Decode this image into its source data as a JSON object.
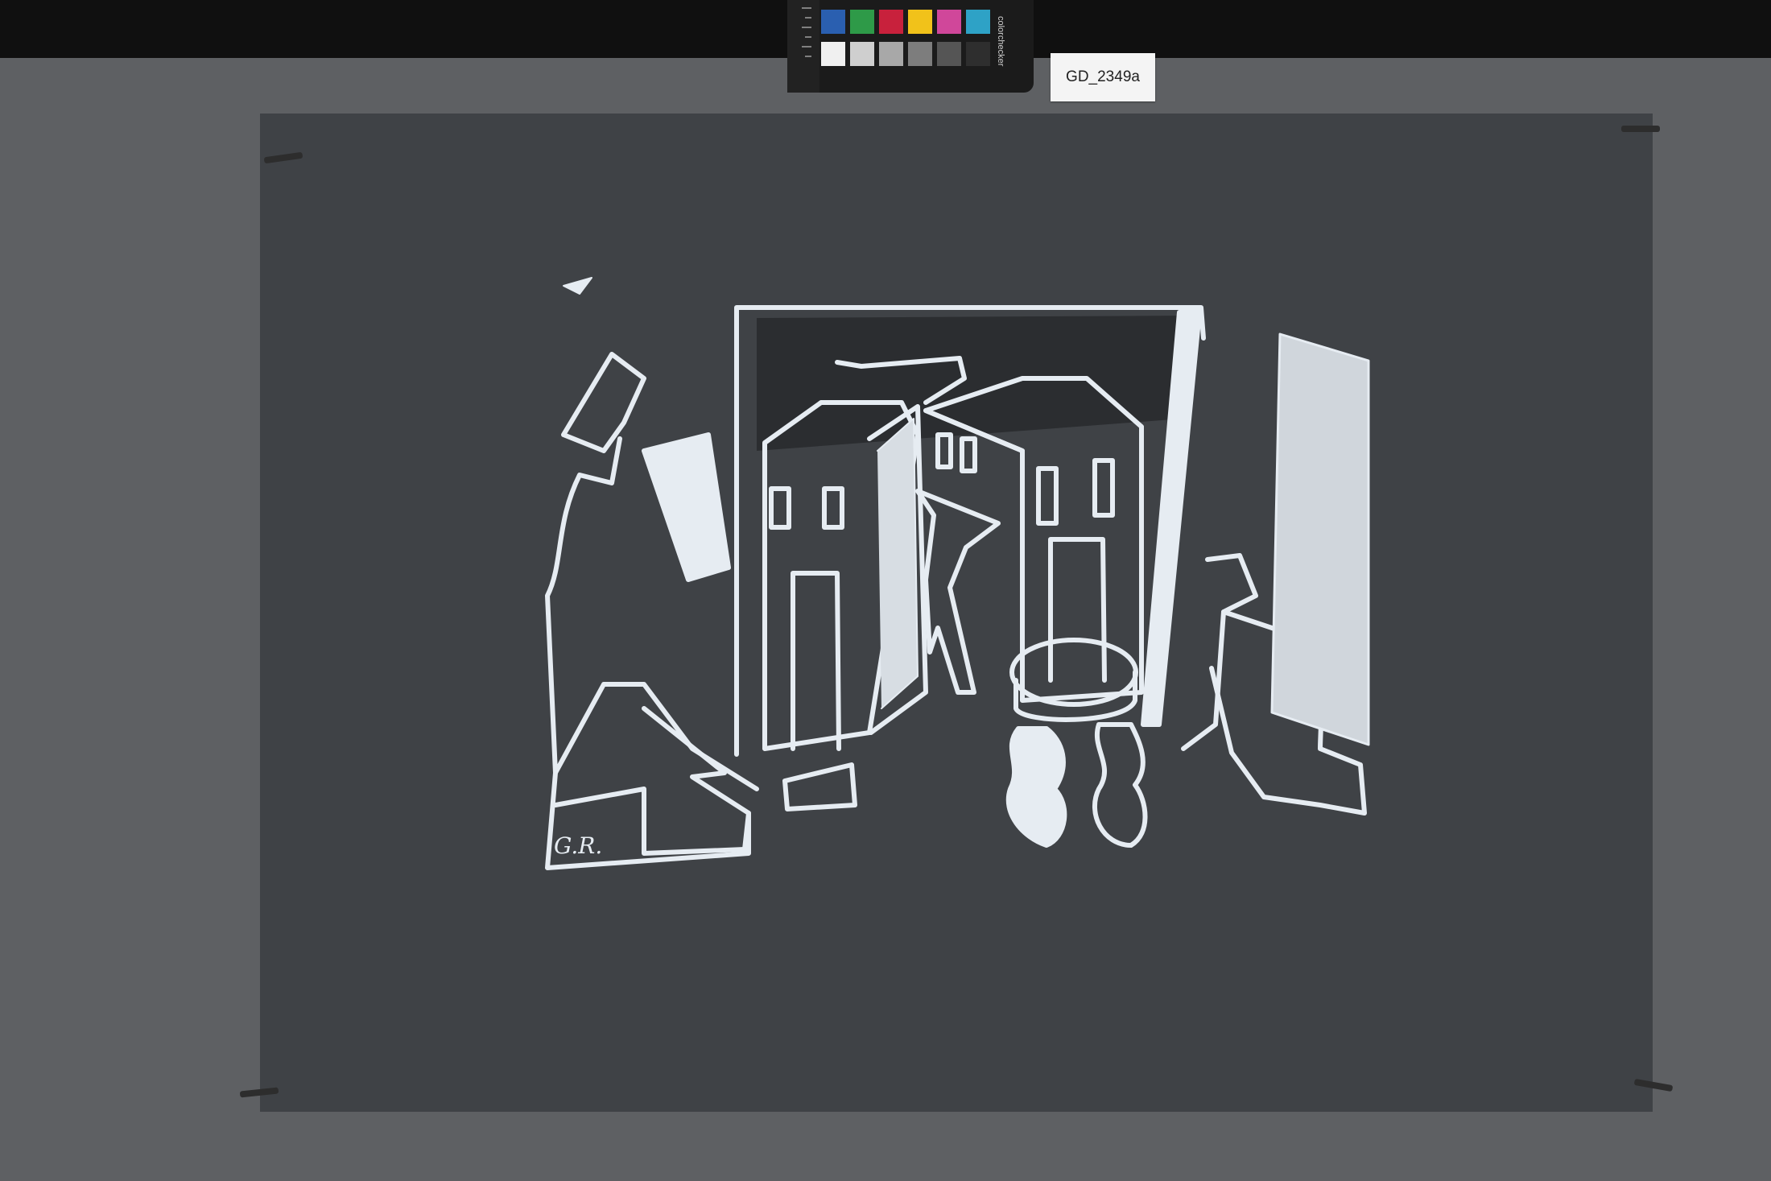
{
  "label_tag": "GD_2349a",
  "signature": "G.R.",
  "calibration_card_text": "colorchecker",
  "colors": {
    "table": "#5e6063",
    "paper": "#3f4246",
    "chalk": "#e6ecf2",
    "black_bar": "#101010"
  },
  "swatches_row1": [
    "#2a5fb0",
    "#2e9a48",
    "#c8213c",
    "#f1c21a",
    "#d0479a",
    "#2ea2c6"
  ],
  "swatches_row2": [
    "#f0f0f0",
    "#cfcfcf",
    "#a8a8a8",
    "#7d7d7d",
    "#555555",
    "#2e2e2e"
  ]
}
